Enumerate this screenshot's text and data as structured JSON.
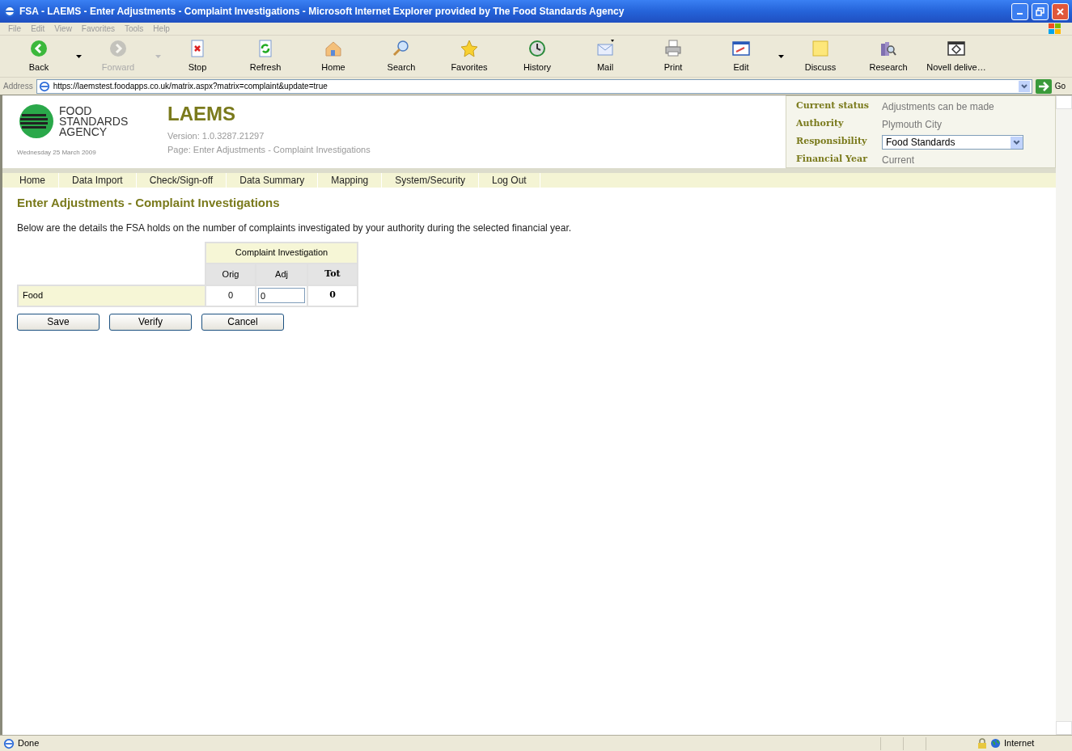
{
  "window": {
    "title": "FSA - LAEMS - Enter Adjustments - Complaint Investigations - Microsoft Internet Explorer provided by The Food Standards Agency"
  },
  "menu": [
    "File",
    "Edit",
    "View",
    "Favorites",
    "Tools",
    "Help"
  ],
  "toolbar": [
    {
      "label": "Back",
      "disabled": false,
      "dropdown": true
    },
    {
      "label": "Forward",
      "disabled": true,
      "dropdown": true
    },
    {
      "label": "Stop",
      "disabled": false,
      "dropdown": false
    },
    {
      "label": "Refresh",
      "disabled": false,
      "dropdown": false
    },
    {
      "label": "Home",
      "disabled": false,
      "dropdown": false
    },
    {
      "label": "Search",
      "disabled": false,
      "dropdown": false
    },
    {
      "label": "Favorites",
      "disabled": false,
      "dropdown": false
    },
    {
      "label": "History",
      "disabled": false,
      "dropdown": false
    },
    {
      "label": "Mail",
      "disabled": false,
      "dropdown": false
    },
    {
      "label": "Print",
      "disabled": false,
      "dropdown": false
    },
    {
      "label": "Edit",
      "disabled": false,
      "dropdown": true
    },
    {
      "label": "Discuss",
      "disabled": false,
      "dropdown": false
    },
    {
      "label": "Research",
      "disabled": false,
      "dropdown": false
    },
    {
      "label": "Novell delive…",
      "disabled": false,
      "dropdown": false
    }
  ],
  "address": {
    "label": "Address",
    "value": "https://laemstest.foodapps.co.uk/matrix.aspx?matrix=complaint&update=true",
    "go": "Go"
  },
  "header": {
    "logo_lines": [
      "FOOD",
      "STANDARDS",
      "AGENCY"
    ],
    "date": "Wednesday 25 March 2009",
    "app_title": "LAEMS",
    "version": "Version: 1.0.3287.21297",
    "page": "Page: Enter Adjustments - Complaint Investigations"
  },
  "info": [
    {
      "label": "Current status",
      "value": "Adjustments can be made",
      "kind": "text"
    },
    {
      "label": "Authority",
      "value": "Plymouth City",
      "kind": "text"
    },
    {
      "label": "Responsibility",
      "value": "Food Standards",
      "kind": "select"
    },
    {
      "label": "Financial Year",
      "value": "Current",
      "kind": "text"
    }
  ],
  "nav": [
    "Home",
    "Data Import",
    "Check/Sign-off",
    "Data Summary",
    "Mapping",
    "System/Security",
    "Log Out"
  ],
  "heading": "Enter Adjustments - Complaint Investigations",
  "intro": "Below are the details the FSA holds on the number of complaints investigated by your authority during the selected financial year.",
  "table": {
    "group": "Complaint Investigation",
    "columns": [
      "Orig",
      "Adj",
      "Tot"
    ],
    "rows": [
      {
        "label": "Food",
        "orig": "0",
        "adj": "0",
        "tot": "0"
      }
    ]
  },
  "buttons": [
    "Save",
    "Verify",
    "Cancel"
  ],
  "status_bar": {
    "text": "Done",
    "zone": "Internet"
  }
}
